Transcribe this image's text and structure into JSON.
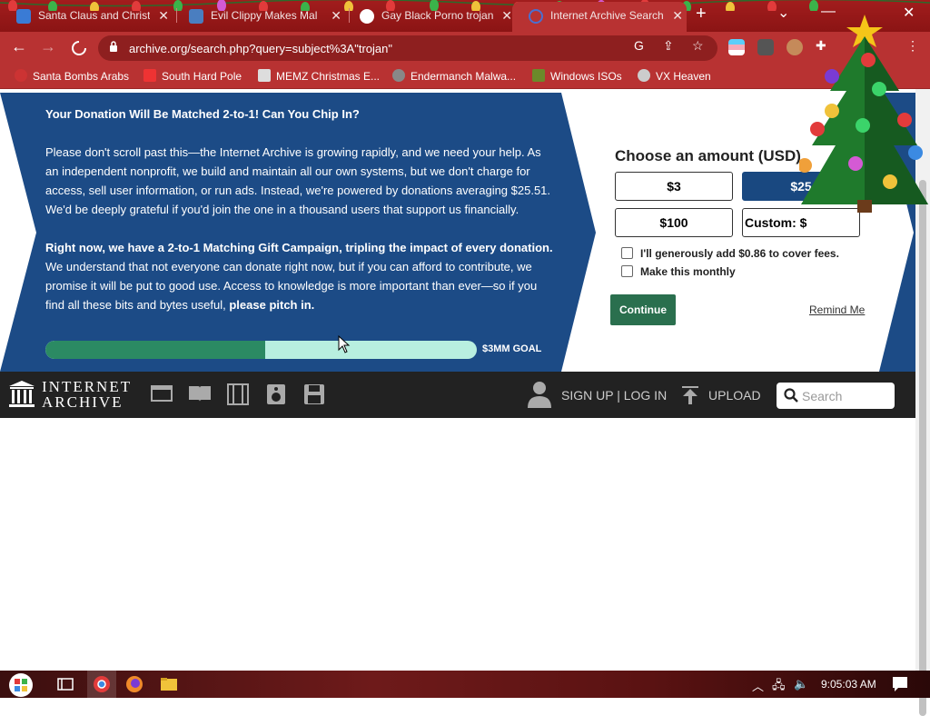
{
  "browser": {
    "tabs": [
      {
        "title": "Santa Claus and Christ",
        "active": false
      },
      {
        "title": "Evil Clippy Makes Mal",
        "active": false
      },
      {
        "title": "Gay Black Porno trojan",
        "active": false
      },
      {
        "title": "Internet Archive Search",
        "active": true
      }
    ],
    "new_tab": "+",
    "url": "archive.org/search.php?query=subject%3A\"trojan\"",
    "bookmarks": [
      {
        "label": "Santa Bombs Arabs"
      },
      {
        "label": "South Hard Pole"
      },
      {
        "label": "MEMZ Christmas E..."
      },
      {
        "label": "Endermanch Malwa..."
      },
      {
        "label": "Windows ISOs"
      },
      {
        "label": "VX Heaven"
      }
    ]
  },
  "donation": {
    "heading": "Your Donation Will Be Matched 2-to-1! Can You Chip In?",
    "para1": "Please don't scroll past this—the Internet Archive is growing rapidly, and we need your help. As an independent nonprofit, we build and maintain all our own systems, but we don't charge for access, sell user information, or run ads. Instead, we're powered by donations averaging $25.51. We'd be deeply grateful if you'd join the one in a thousand users that support us financially.",
    "para2_bold": "Right now, we have a 2-to-1 Matching Gift Campaign, tripling the impact of every donation.",
    "para2_text": " We understand that not everyone can donate right now, but if you can afford to contribute, we promise it will be put to good use. Access to knowledge is more important than ever—so if you find all these bits and bytes useful, ",
    "para2_end": "please pitch in.",
    "progress_fraction": 0.51,
    "goal": "$3MM GOAL",
    "choose_label": "Choose an amount (USD)",
    "amounts": [
      "$3",
      "$25",
      "$100"
    ],
    "custom_label": "Custom: $",
    "fee_label": "I'll generously add $0.86 to cover fees.",
    "monthly_label": "Make this monthly",
    "continue": "Continue",
    "remind": "Remind Me"
  },
  "ia_nav": {
    "logo_line1": "INTERNET",
    "logo_line2": "ARCHIVE",
    "signup": "SIGN UP | LOG IN",
    "upload": "UPLOAD",
    "search_placeholder": "Search"
  },
  "taskbar": {
    "clock": "9:05:03 AM"
  }
}
